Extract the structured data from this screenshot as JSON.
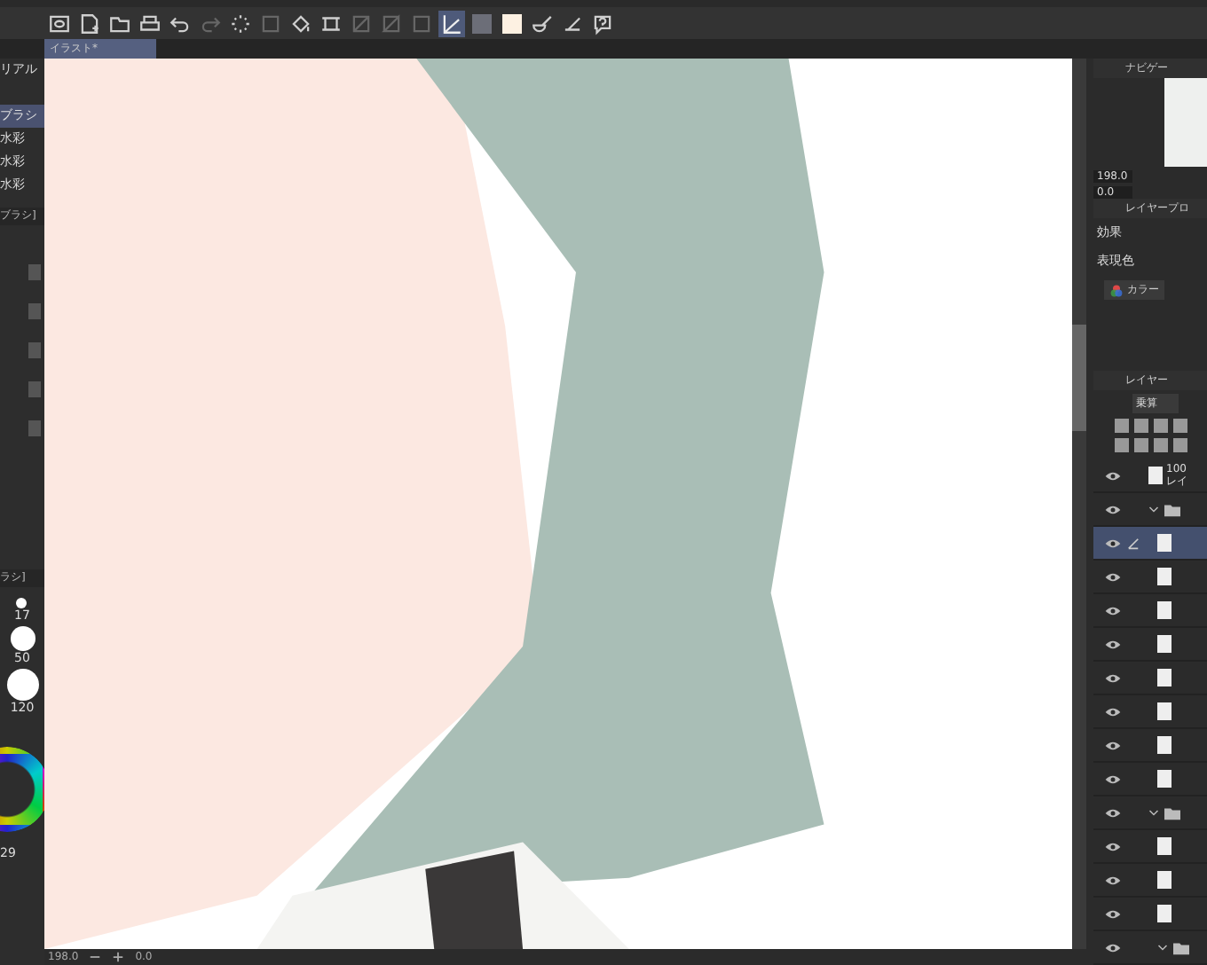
{
  "toolbar": [
    {
      "kind": "canvas",
      "selected": false,
      "disabled": false
    },
    {
      "kind": "new",
      "selected": false,
      "disabled": false
    },
    {
      "kind": "open",
      "selected": false,
      "disabled": false
    },
    {
      "kind": "print",
      "selected": false,
      "disabled": false
    },
    {
      "kind": "undo",
      "selected": false,
      "disabled": false
    },
    {
      "kind": "redo",
      "selected": false,
      "disabled": true
    },
    {
      "kind": "dots",
      "selected": false,
      "disabled": false
    },
    {
      "kind": "square",
      "selected": false,
      "disabled": true
    },
    {
      "kind": "fill",
      "selected": false,
      "disabled": false
    },
    {
      "kind": "frame",
      "selected": false,
      "disabled": false
    },
    {
      "kind": "slash",
      "selected": false,
      "disabled": true
    },
    {
      "kind": "half",
      "selected": false,
      "disabled": true
    },
    {
      "kind": "square",
      "selected": false,
      "disabled": true
    },
    {
      "kind": "ruler",
      "selected": true,
      "disabled": false
    },
    {
      "kind": "swatch",
      "selected": false,
      "disabled": false,
      "color": "#6c6e78"
    },
    {
      "kind": "swatch",
      "selected": false,
      "disabled": false,
      "color": "#fdf1e2"
    },
    {
      "kind": "brush",
      "selected": false,
      "disabled": false
    },
    {
      "kind": "pen",
      "selected": false,
      "disabled": false
    },
    {
      "kind": "help",
      "selected": false,
      "disabled": false
    }
  ],
  "document_tab": {
    "title": "イラスト*",
    "selected": true
  },
  "left_panel": {
    "title": "リアル",
    "brushes": [
      {
        "label": "ブラシ",
        "selected": true
      },
      {
        "label": "水彩",
        "selected": false
      },
      {
        "label": "水彩",
        "selected": false
      },
      {
        "label": "水彩",
        "selected": false
      }
    ],
    "settings_title": "ブラシ]",
    "size_title": "ラシ]",
    "sizes": [
      "17",
      "50",
      "120"
    ],
    "color_value": "29"
  },
  "status_bar": {
    "zoom": "198.0",
    "angle": "0.0"
  },
  "navigator": {
    "title": "ナビゲー",
    "zoom": "198.0",
    "angle": "0.0"
  },
  "layer_property": {
    "title": "レイヤープロ",
    "effect_label": "効果",
    "expression_label": "表現色",
    "color_button": "カラー"
  },
  "layers_panel": {
    "title": "レイヤー",
    "blend_mode": "乗算",
    "layers": [
      {
        "kind": "layer",
        "opacity": "100",
        "name": "レイ",
        "visible": true,
        "selected": false
      },
      {
        "kind": "folder",
        "visible": true,
        "expanded": true,
        "children": [
          {
            "kind": "layer",
            "visible": true,
            "selected": true
          },
          {
            "kind": "layer",
            "visible": true,
            "selected": false
          },
          {
            "kind": "layer",
            "visible": true,
            "selected": false
          },
          {
            "kind": "layer",
            "visible": true,
            "selected": false
          },
          {
            "kind": "layer",
            "visible": true,
            "selected": false
          },
          {
            "kind": "layer",
            "visible": true,
            "selected": false
          },
          {
            "kind": "layer",
            "visible": true,
            "selected": false
          },
          {
            "kind": "layer",
            "visible": true,
            "selected": false
          }
        ]
      },
      {
        "kind": "folder",
        "visible": true,
        "expanded": true,
        "children": [
          {
            "kind": "layer",
            "visible": true,
            "selected": false
          },
          {
            "kind": "layer",
            "visible": true,
            "selected": false
          },
          {
            "kind": "layer",
            "visible": true,
            "selected": false
          },
          {
            "kind": "folder",
            "visible": true,
            "expanded": true
          }
        ]
      }
    ]
  }
}
